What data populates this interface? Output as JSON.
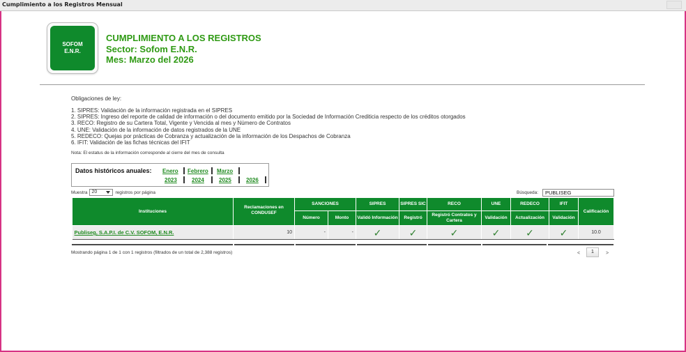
{
  "window": {
    "title": "Cumplimiento a los Registros Mensual"
  },
  "logo": {
    "line1": "SOFOM",
    "line2": "E.N.R."
  },
  "header": {
    "title": "CUMPLIMIENTO A LOS REGISTROS",
    "sector": "Sector: Sofom E.N.R.",
    "mes": "Mes: Marzo del 2026"
  },
  "obligaciones": {
    "intro": "Obligaciones de ley:",
    "items": [
      "1. SIPRES: Validación de la información registrada en el SIPRES",
      "2. SIPRES: Ingreso del reporte de calidad de información o del documento emitido por la Sociedad de Información Crediticia respecto de los créditos otorgados",
      "3. RECO: Registro de su Cartera Total, Vigente y Vencida al mes y Número de Contratos",
      "4. UNE: Validación de la información de datos registrados de la UNE",
      "5. REDECO: Quejas por prácticas de Cobranza y actualización de la información de los Despachos de Cobranza",
      "6. IFIT: Validación de las fichas técnicas del IFIT"
    ],
    "nota": "Nota: El estatus de la información corresponde al cierre del mes de consulta"
  },
  "historicos": {
    "label": "Datos históricos anuales:",
    "meses": [
      "Enero",
      "Febrero",
      "Marzo"
    ],
    "anios": [
      "2023",
      "2024",
      "2025",
      "2026"
    ]
  },
  "controls": {
    "muestra_prefix": "Muestra",
    "muestra_value": "20",
    "muestra_suffix": "registros por página",
    "busqueda_label": "Búsqueda:",
    "busqueda_value": "PUBLISEG"
  },
  "table": {
    "headers": {
      "instituciones": "Instituciones",
      "reclamaciones": "Reclamaciones en CONDUSEF",
      "sanciones": "SANCIONES",
      "numero": "Número",
      "monto": "Monto",
      "sipres": "SIPRES",
      "valido_informacion": "Validó Información",
      "sipres_sic": "SIPRES SIC",
      "registro": "Registró",
      "reco": "RECO",
      "registro_contratos": "Registró Contratos y Cartera",
      "une": "UNE",
      "une_validacion": "Validación",
      "redeco": "REDECO",
      "actualizacion": "Actualización",
      "ifit": "IFIT",
      "ifit_validacion": "Validación",
      "calificacion": "Calificación"
    },
    "rows": [
      {
        "institucion": "Publiseg, S.A.P.I. de C.V. SOFOM, E.N.R.",
        "reclamaciones": "10",
        "numero": "-",
        "monto": "-",
        "check_icon": "✓",
        "calificacion": "10.0"
      }
    ]
  },
  "footer": {
    "mostrando": "Mostrando página 1 de 1 con 1 registros (filtrados de un total de 2,388 registros)",
    "prev": "<",
    "page": "1",
    "next": ">"
  },
  "colors": {
    "green": "#0f8a2c",
    "link_green": "#1f8a1f",
    "heading_green": "#2f9a14",
    "border_pink": "#d63384"
  }
}
